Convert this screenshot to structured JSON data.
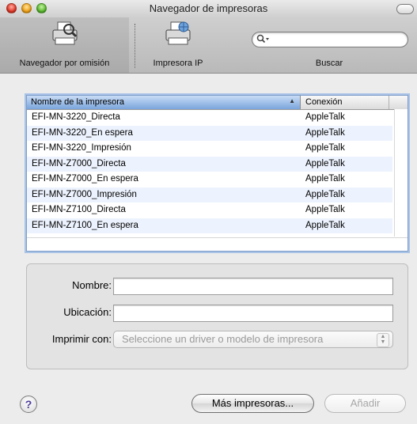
{
  "window": {
    "title": "Navegador de impresoras"
  },
  "toolbar": {
    "default_browser_label": "Navegador por omisión",
    "ip_printer_label": "Impresora IP",
    "search_label": "Buscar",
    "search_placeholder": ""
  },
  "printer_list": {
    "columns": {
      "name": "Nombre de la impresora",
      "connection": "Conexión"
    },
    "sort_indicator": "▲",
    "rows": [
      {
        "name": "EFI-MN-3220_Directa",
        "connection": "AppleTalk"
      },
      {
        "name": "EFI-MN-3220_En espera",
        "connection": "AppleTalk"
      },
      {
        "name": "EFI-MN-3220_Impresión",
        "connection": "AppleTalk"
      },
      {
        "name": "EFI-MN-Z7000_Directa",
        "connection": "AppleTalk"
      },
      {
        "name": "EFI-MN-Z7000_En espera",
        "connection": "AppleTalk"
      },
      {
        "name": "EFI-MN-Z7000_Impresión",
        "connection": "AppleTalk"
      },
      {
        "name": "EFI-MN-Z7100_Directa",
        "connection": "AppleTalk"
      },
      {
        "name": "EFI-MN-Z7100_En espera",
        "connection": "AppleTalk"
      }
    ]
  },
  "details": {
    "name_label": "Nombre:",
    "name_value": "",
    "location_label": "Ubicación:",
    "location_value": "",
    "print_with_label": "Imprimir con:",
    "print_with_value": "Seleccione un driver o modelo de impresora"
  },
  "buttons": {
    "help": "?",
    "more_printers": "Más impresoras...",
    "add": "Añadir"
  }
}
